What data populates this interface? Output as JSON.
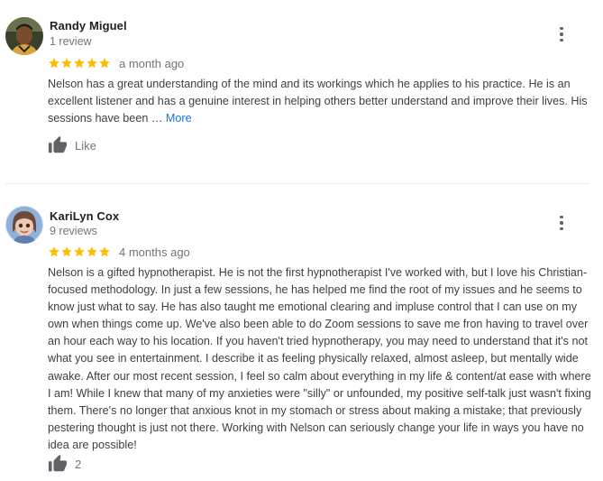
{
  "reviews": [
    {
      "author": "Randy Miguel",
      "review_count": "1 review",
      "rating": 5,
      "date": "a month ago",
      "text": "Nelson has a great understanding of the mind and its workings which he applies to his practice. He is an excellent listener and has a genuine interest in helping others better understand and improve their lives. His sessions have been … ",
      "more_label": "More",
      "like_label": "Like"
    },
    {
      "author": "KariLyn Cox",
      "review_count": "9 reviews",
      "rating": 5,
      "date": "4 months ago",
      "text": "Nelson is a gifted hypnotherapist. He is not the first hypnotherapist I've worked with, but I love his Christian-focused methodology. In just a few sessions, he has helped me find the root of my issues and he seems to know just what to say. He has also taught me emotional clearing and impluse control that I can use on my own when things come up. We've also been able to do Zoom sessions to save me fron having to travel over an hour each way to his location. If you haven't tried hypnotherapy, you may need to understand that it's not what you see in entertainment. I describe it as feeling physically relaxed, almost asleep, but mentally wide awake. After our most recent session, I feel so calm about everything in my life & content/at ease with where I am! While I knew that many of my anxieties were \"silly\" or unfounded, my positive self-talk just wasn't fixing them. There's no longer that anxious knot in my stomach or stress about making a mistake; that previously pestering thought is just not there. Working with Nelson can seriously change your life in ways you have no idea are possible!",
      "like_count": "2"
    }
  ],
  "colors": {
    "star": "#fbbc04",
    "link": "#1a73e8",
    "muted": "#70757a",
    "icon": "#5f6368"
  },
  "icons": {
    "menu": "more-vert-icon",
    "like": "thumb-up-icon",
    "star": "star-icon"
  }
}
